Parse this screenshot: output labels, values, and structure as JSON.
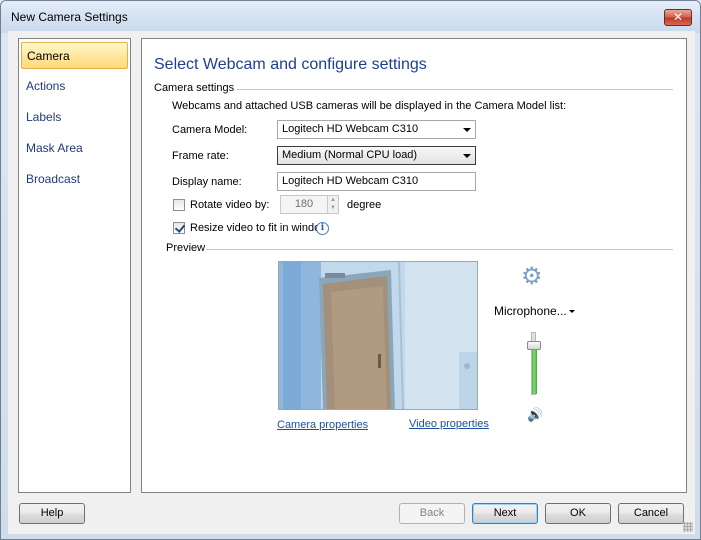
{
  "window": {
    "title": "New Camera Settings",
    "close_glyph": "✕"
  },
  "sidebar": {
    "items": [
      {
        "label": "Camera",
        "active": true
      },
      {
        "label": "Actions"
      },
      {
        "label": "Labels"
      },
      {
        "label": "Mask Area"
      },
      {
        "label": "Broadcast"
      }
    ]
  },
  "main": {
    "heading": "Select Webcam and configure settings",
    "camera_settings": {
      "group_label": "Camera settings",
      "description": "Webcams and attached USB cameras will be displayed in the Camera Model list:",
      "camera_model_label": "Camera Model:",
      "camera_model_value": "Logitech HD Webcam C310",
      "frame_rate_label": "Frame rate:",
      "frame_rate_value": "Medium (Normal CPU load)",
      "display_name_label": "Display name:",
      "display_name_value": "Logitech HD Webcam C310",
      "rotate_label": "Rotate video by:",
      "rotate_checked": false,
      "rotate_value": "180",
      "rotate_unit": "degree",
      "resize_label": "Resize video to fit in window",
      "resize_checked": true,
      "info_glyph": "i"
    },
    "preview": {
      "group_label": "Preview",
      "camera_properties_link": "Camera properties",
      "video_properties_link": "Video properties",
      "microphone_label": "Microphone...",
      "volume_level": 0.75,
      "gear_icon": "gear-icon",
      "gear_glyph": "⚙",
      "speaker_glyph": "🔊"
    }
  },
  "footer": {
    "help": "Help",
    "back": "Back",
    "next": "Next",
    "ok": "OK",
    "cancel": "Cancel"
  }
}
